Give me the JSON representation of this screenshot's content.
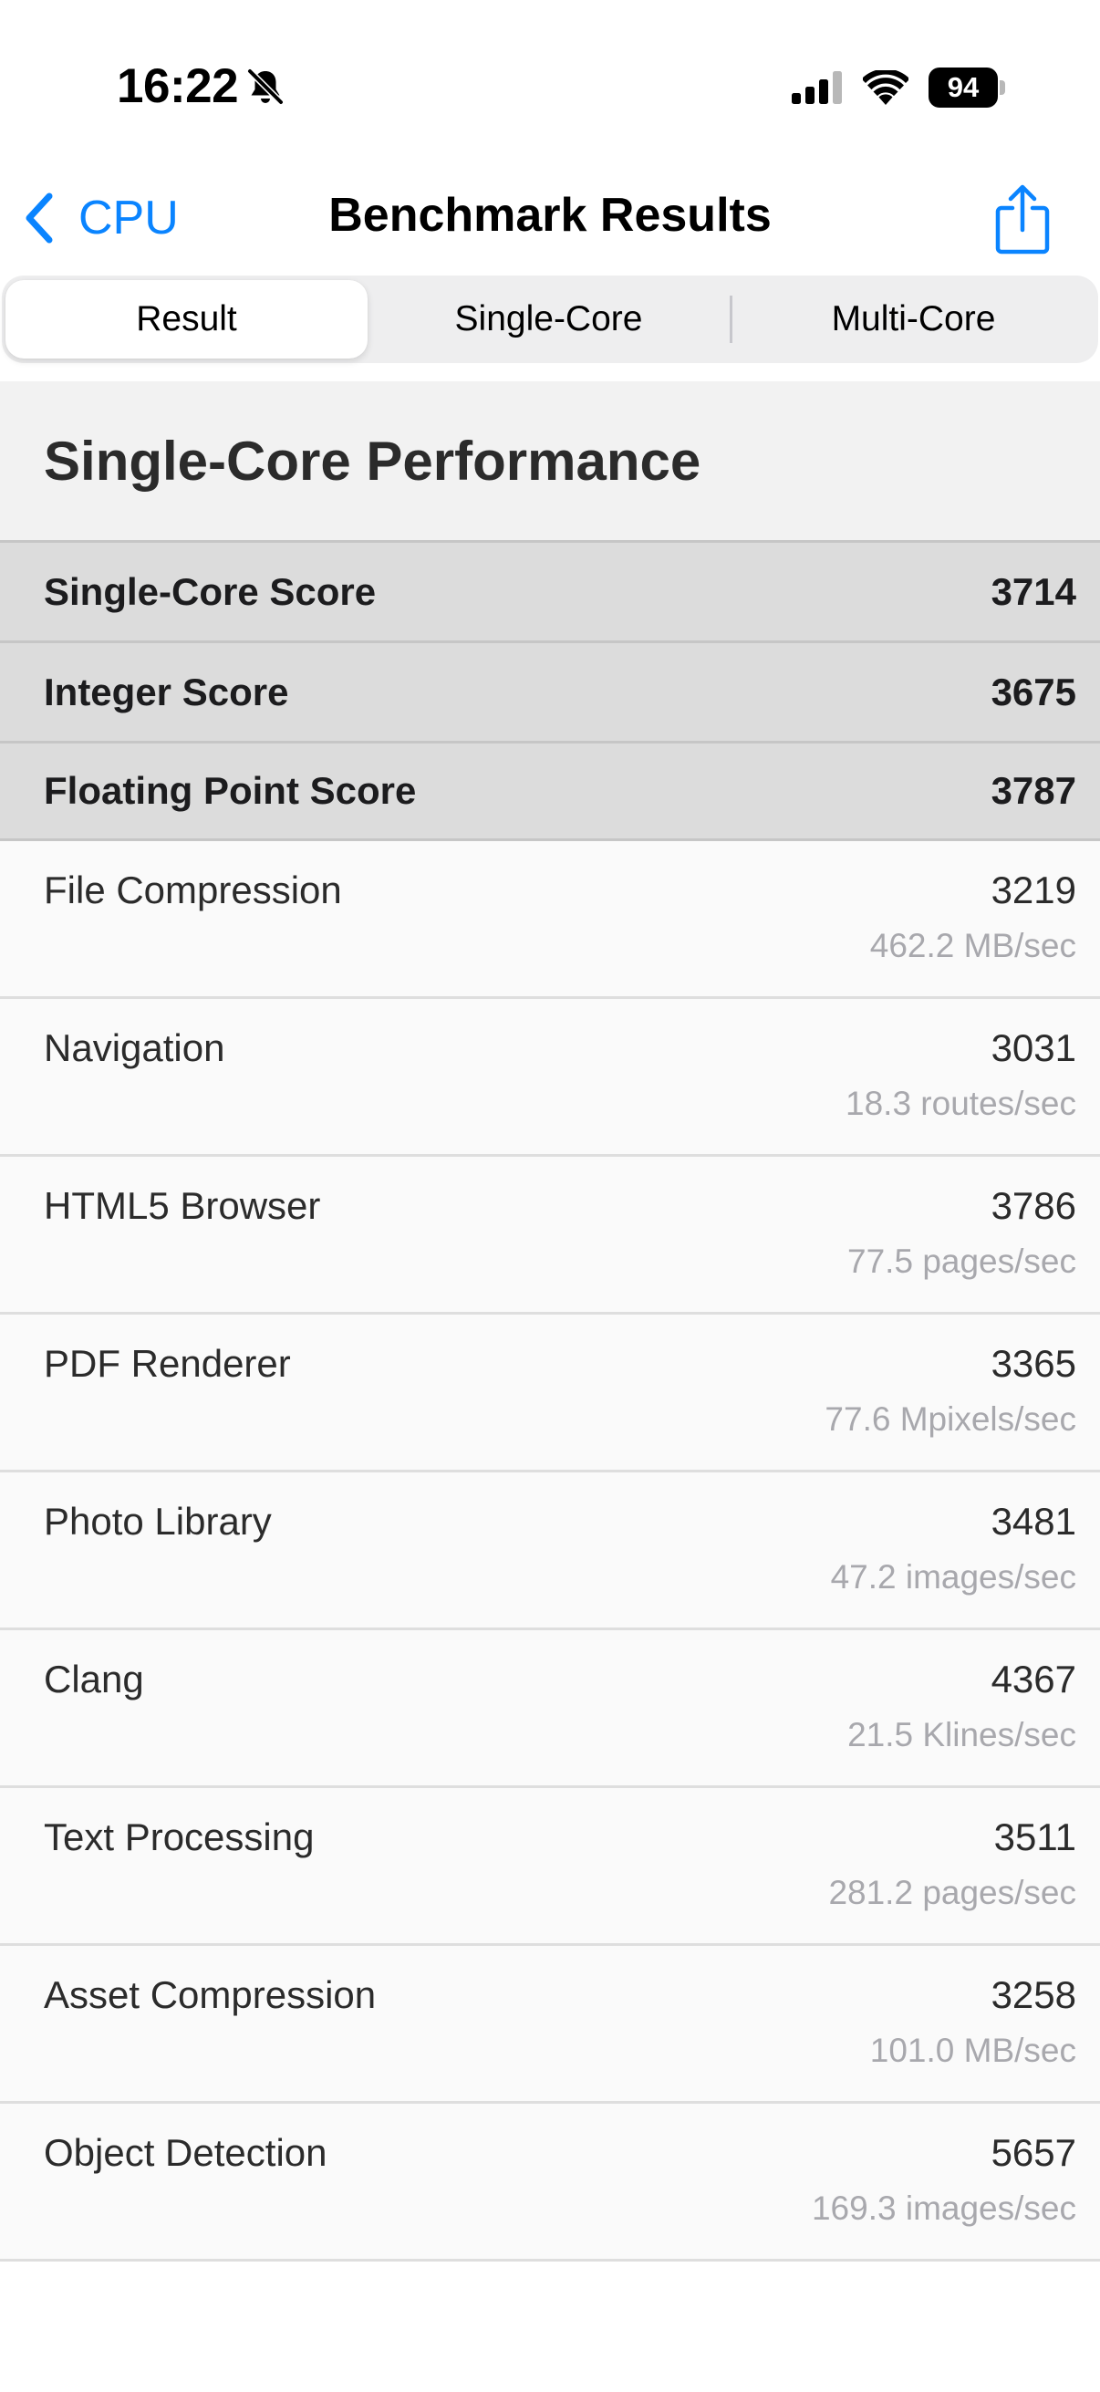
{
  "status_bar": {
    "time": "16:22",
    "battery": "94",
    "icons": [
      "bell-slash-icon",
      "cellular-signal-icon",
      "wifi-icon",
      "battery-icon"
    ]
  },
  "nav": {
    "back_label": "CPU",
    "title": "Benchmark Results",
    "share_icon": "share-icon",
    "accent_color": "#0a84ff"
  },
  "tabs": [
    {
      "label": "Result",
      "selected": true
    },
    {
      "label": "Single-Core",
      "selected": false
    },
    {
      "label": "Multi-Core",
      "selected": false
    }
  ],
  "section": {
    "title": "Single-Core Performance"
  },
  "summary": [
    {
      "label": "Single-Core Score",
      "value": "3714"
    },
    {
      "label": "Integer Score",
      "value": "3675"
    },
    {
      "label": "Floating Point Score",
      "value": "3787"
    }
  ],
  "benchmarks": [
    {
      "name": "File Compression",
      "score": "3219",
      "rate": "462.2 MB/sec"
    },
    {
      "name": "Navigation",
      "score": "3031",
      "rate": "18.3 routes/sec"
    },
    {
      "name": "HTML5 Browser",
      "score": "3786",
      "rate": "77.5 pages/sec"
    },
    {
      "name": "PDF Renderer",
      "score": "3365",
      "rate": "77.6 Mpixels/sec"
    },
    {
      "name": "Photo Library",
      "score": "3481",
      "rate": "47.2 images/sec"
    },
    {
      "name": "Clang",
      "score": "4367",
      "rate": "21.5 Klines/sec"
    },
    {
      "name": "Text Processing",
      "score": "3511",
      "rate": "281.2 pages/sec"
    },
    {
      "name": "Asset Compression",
      "score": "3258",
      "rate": "101.0 MB/sec"
    },
    {
      "name": "Object Detection",
      "score": "5657",
      "rate": "169.3 images/sec"
    }
  ]
}
